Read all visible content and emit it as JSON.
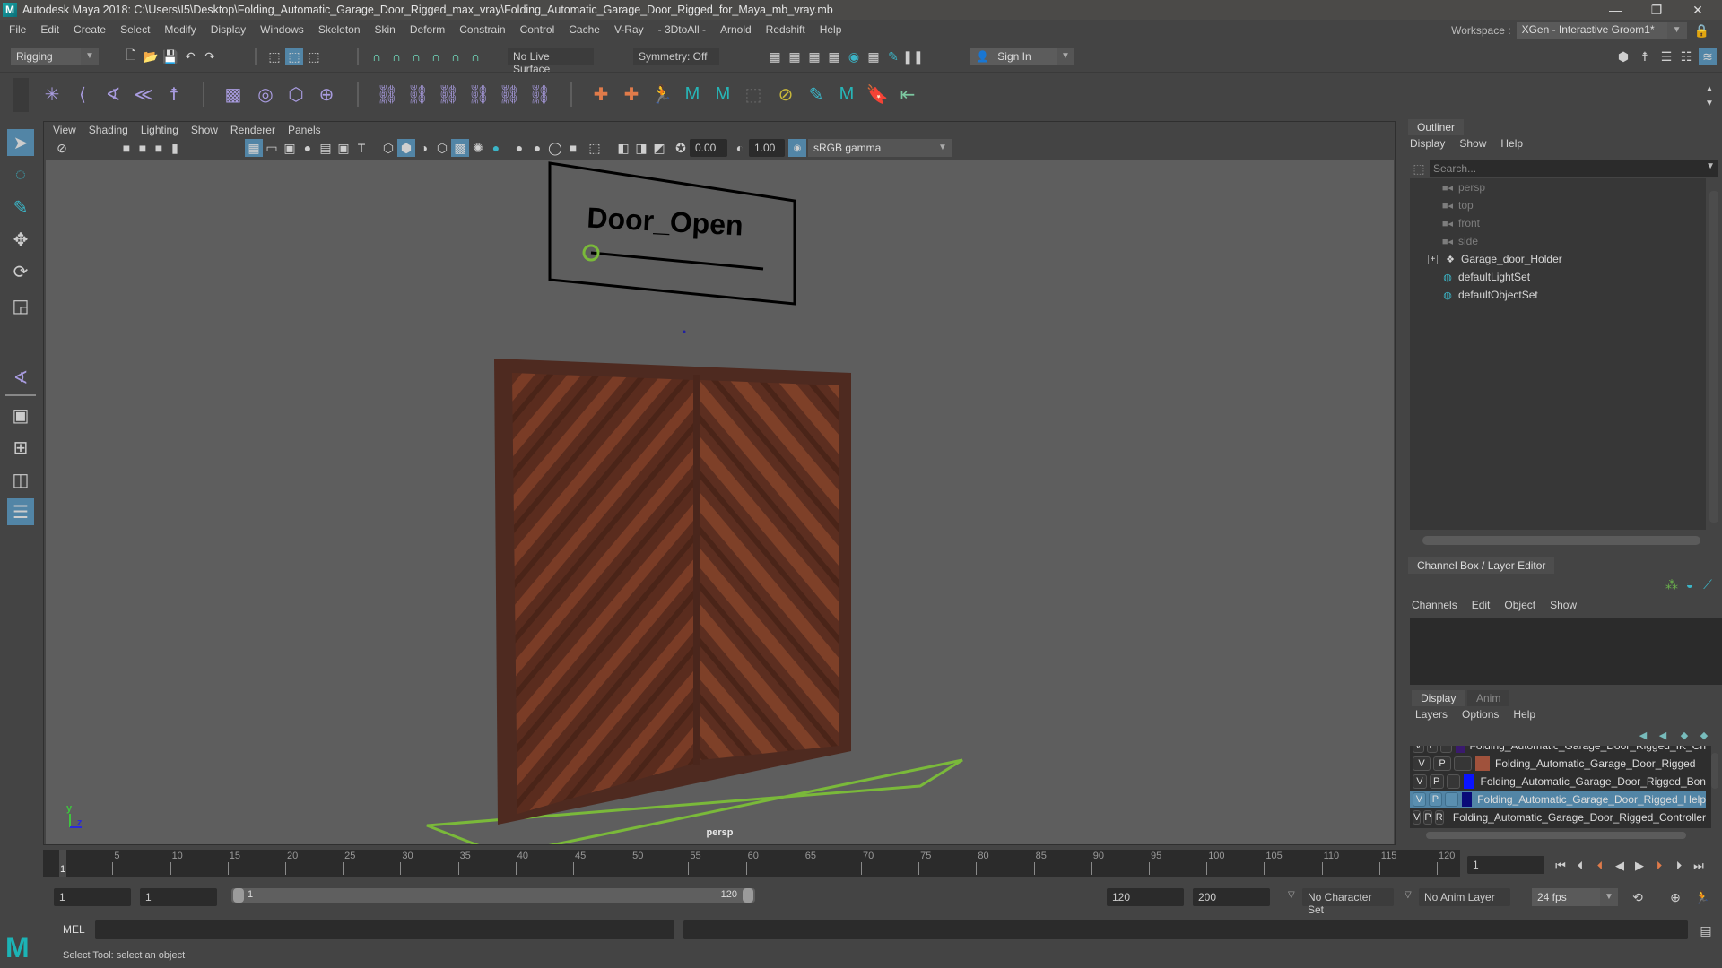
{
  "window": {
    "title": "Autodesk Maya 2018: C:\\Users\\I5\\Desktop\\Folding_Automatic_Garage_Door_Rigged_max_vray\\Folding_Automatic_Garage_Door_Rigged_for_Maya_mb_vray.mb",
    "controls": {
      "minimize": "—",
      "restore": "❐",
      "close": "✕"
    }
  },
  "menubar": {
    "items": [
      "File",
      "Edit",
      "Create",
      "Select",
      "Modify",
      "Display",
      "Windows",
      "Skeleton",
      "Skin",
      "Deform",
      "Constrain",
      "Control",
      "Cache",
      "V-Ray",
      "- 3DtoAll -",
      "Arnold",
      "Redshift",
      "Help"
    ]
  },
  "workspace": {
    "label": "Workspace :",
    "value": "XGen - Interactive Groom1*"
  },
  "statusline": {
    "menuset": "Rigging",
    "live_surface": "No Live Surface",
    "symmetry": "Symmetry: Off",
    "sign_in": "Sign In"
  },
  "viewport": {
    "menu": [
      "View",
      "Shading",
      "Lighting",
      "Show",
      "Renderer",
      "Panels"
    ],
    "exposure": "0.00",
    "gamma": "1.00",
    "color_space": "sRGB gamma",
    "camera_label": "persp",
    "scene_label": "Door_Open",
    "axis": {
      "y": "y",
      "z": "z"
    }
  },
  "outliner": {
    "title": "Outliner",
    "menu": [
      "Display",
      "Show",
      "Help"
    ],
    "search_placeholder": "Search...",
    "items": [
      {
        "label": "persp",
        "icon": "camera-icon",
        "dim": true
      },
      {
        "label": "top",
        "icon": "camera-icon",
        "dim": true
      },
      {
        "label": "front",
        "icon": "camera-icon",
        "dim": true
      },
      {
        "label": "side",
        "icon": "camera-icon",
        "dim": true
      },
      {
        "label": "Garage_door_Holder",
        "icon": "group-icon",
        "dim": false,
        "expandable": true
      },
      {
        "label": "defaultLightSet",
        "icon": "set-icon",
        "dim": false
      },
      {
        "label": "defaultObjectSet",
        "icon": "set-icon",
        "dim": false
      }
    ]
  },
  "channelbox": {
    "title": "Channel Box / Layer Editor",
    "menu": [
      "Channels",
      "Edit",
      "Object",
      "Show"
    ]
  },
  "layer_editor": {
    "tabs": [
      "Display",
      "Anim"
    ],
    "active_tab": "Display",
    "menu": [
      "Layers",
      "Options",
      "Help"
    ],
    "layers": [
      {
        "v": "V",
        "p": "P",
        "r": "",
        "color": "#3a1a6e",
        "name": "Folding_Automatic_Garage_Door_Rigged_IK_Ch",
        "selected": false
      },
      {
        "v": "V",
        "p": "P",
        "r": "",
        "color": "#a0523c",
        "name": "Folding_Automatic_Garage_Door_Rigged",
        "selected": false
      },
      {
        "v": "V",
        "p": "P",
        "r": "",
        "color": "#0a14ff",
        "name": "Folding_Automatic_Garage_Door_Rigged_Bon",
        "selected": false
      },
      {
        "v": "V",
        "p": "P",
        "r": "",
        "color": "#0a0a78",
        "name": "Folding_Automatic_Garage_Door_Rigged_Help",
        "selected": true
      },
      {
        "v": "V",
        "p": "P",
        "r": "R",
        "color": "#0c5a1e",
        "name": "Folding_Automatic_Garage_Door_Rigged_Controller",
        "selected": false
      }
    ]
  },
  "timeslider": {
    "start": 1,
    "end": 120,
    "current_frame": "1",
    "ticks": [
      5,
      10,
      15,
      20,
      25,
      30,
      35,
      40,
      45,
      50,
      55,
      60,
      65,
      70,
      75,
      80,
      85,
      90,
      95,
      100,
      105,
      110,
      115,
      120
    ]
  },
  "range": {
    "start_field": "1",
    "playback_start": "1",
    "range_start_label": "1",
    "range_end_label": "120",
    "playback_end": "120",
    "end_field": "200",
    "character_set": "No Character Set",
    "anim_layer": "No Anim Layer",
    "fps": "24 fps"
  },
  "commandline": {
    "label": "MEL",
    "value": ""
  },
  "helpline": {
    "text": "Select Tool: select an object"
  },
  "colors": {
    "accent": "#5285a6",
    "viewport_bg": "#5e5e5e",
    "grid_green": "#7ab93a",
    "door_wood": "#6b3524"
  }
}
